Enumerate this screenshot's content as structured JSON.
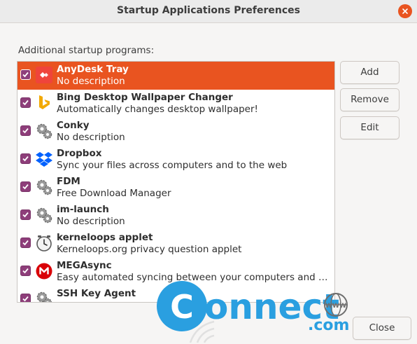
{
  "window": {
    "title": "Startup Applications Preferences"
  },
  "section_label": "Additional startup programs:",
  "programs": [
    {
      "name": "AnyDesk Tray",
      "desc": "No description",
      "checked": true,
      "selected": true,
      "icon": "anydesk-icon"
    },
    {
      "name": "Bing Desktop Wallpaper Changer",
      "desc": "Automatically changes desktop wallpaper!",
      "checked": true,
      "selected": false,
      "icon": "bing-icon"
    },
    {
      "name": "Conky",
      "desc": "No description",
      "checked": true,
      "selected": false,
      "icon": "gears-icon"
    },
    {
      "name": "Dropbox",
      "desc": "Sync your files across computers and to the web",
      "checked": true,
      "selected": false,
      "icon": "dropbox-icon"
    },
    {
      "name": "FDM",
      "desc": "Free Download Manager",
      "checked": true,
      "selected": false,
      "icon": "gears-icon"
    },
    {
      "name": "im-launch",
      "desc": "No description",
      "checked": true,
      "selected": false,
      "icon": "gears-icon"
    },
    {
      "name": "kerneloops applet",
      "desc": "Kerneloops.org privacy question applet",
      "checked": true,
      "selected": false,
      "icon": "clock-icon"
    },
    {
      "name": "MEGAsync",
      "desc": "Easy automated syncing between your computers and your MEGA cloud drive",
      "checked": true,
      "selected": false,
      "icon": "mega-icon"
    },
    {
      "name": "SSH Key Agent",
      "desc": "",
      "checked": true,
      "selected": false,
      "icon": "gears-icon"
    }
  ],
  "buttons": {
    "add": "Add",
    "remove": "Remove",
    "edit": "Edit",
    "close": "Close"
  },
  "watermark": {
    "main": "onnect",
    "letter_c": "C",
    "www": "WWW",
    "dotcom": ".com"
  },
  "colors": {
    "accent": "#e95420",
    "checkbox": "#8e3e7a",
    "watermark_blue": "#2a9fe0"
  }
}
